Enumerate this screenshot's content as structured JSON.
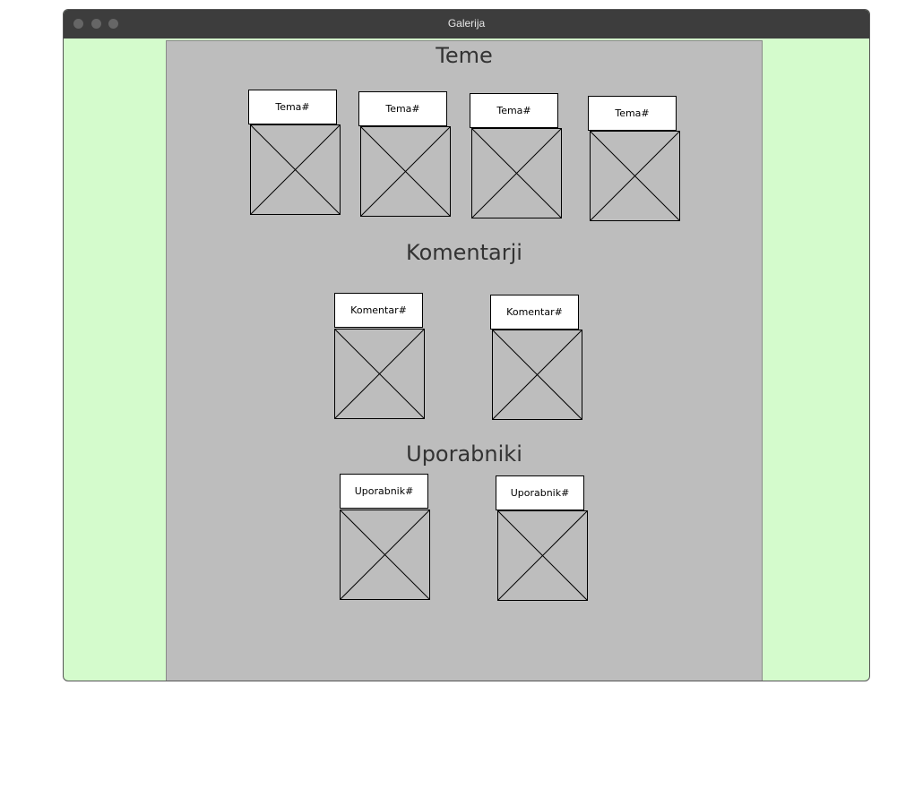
{
  "window": {
    "title": "Galerija"
  },
  "sections": {
    "topics": {
      "heading": "Teme",
      "items": [
        {
          "label": "Tema#"
        },
        {
          "label": "Tema#"
        },
        {
          "label": "Tema#"
        },
        {
          "label": "Tema#"
        }
      ]
    },
    "comments": {
      "heading": "Komentarji",
      "items": [
        {
          "label": "Komentar#"
        },
        {
          "label": "Komentar#"
        }
      ]
    },
    "users": {
      "heading": "Uporabniki",
      "items": [
        {
          "label": "Uporabnik#"
        },
        {
          "label": "Uporabnik#"
        }
      ]
    }
  },
  "icons": {
    "window_controls": [
      "window-close-icon",
      "window-minimize-icon",
      "window-maximize-icon"
    ],
    "image_placeholder": "image-placeholder-icon"
  }
}
